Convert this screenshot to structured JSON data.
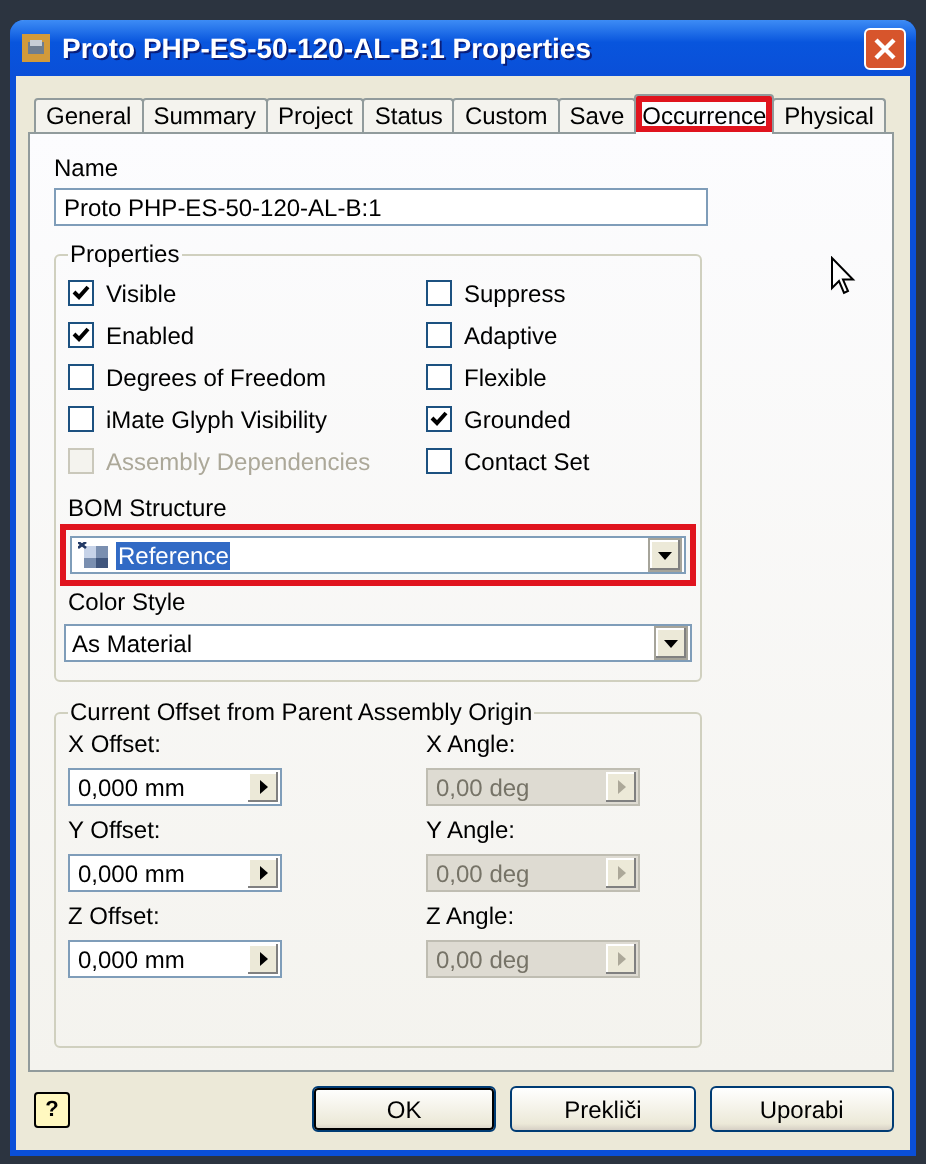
{
  "window": {
    "title": "Proto PHP-ES-50-120-AL-B:1 Properties"
  },
  "tabs": [
    {
      "label": "General",
      "selected": false,
      "highlighted": false
    },
    {
      "label": "Summary",
      "selected": false,
      "highlighted": false
    },
    {
      "label": "Project",
      "selected": false,
      "highlighted": false
    },
    {
      "label": "Status",
      "selected": false,
      "highlighted": false
    },
    {
      "label": "Custom",
      "selected": false,
      "highlighted": false
    },
    {
      "label": "Save",
      "selected": false,
      "highlighted": false
    },
    {
      "label": "Occurrence",
      "selected": true,
      "highlighted": true
    },
    {
      "label": "Physical",
      "selected": false,
      "highlighted": false
    }
  ],
  "name": {
    "label": "Name",
    "value": "Proto PHP-ES-50-120-AL-B:1"
  },
  "properties": {
    "title": "Properties",
    "checkboxes": [
      {
        "label": "Visible",
        "checked": true,
        "disabled": false
      },
      {
        "label": "Suppress",
        "checked": false,
        "disabled": false
      },
      {
        "label": "Enabled",
        "checked": true,
        "disabled": false
      },
      {
        "label": "Adaptive",
        "checked": false,
        "disabled": false
      },
      {
        "label": "Degrees of Freedom",
        "checked": false,
        "disabled": false
      },
      {
        "label": "Flexible",
        "checked": false,
        "disabled": false
      },
      {
        "label": "iMate Glyph Visibility",
        "checked": false,
        "disabled": false
      },
      {
        "label": "Grounded",
        "checked": true,
        "disabled": false
      },
      {
        "label": "Assembly Dependencies",
        "checked": false,
        "disabled": true
      },
      {
        "label": "Contact Set",
        "checked": false,
        "disabled": false
      }
    ],
    "bom_structure": {
      "label": "BOM Structure",
      "value": "Reference",
      "highlighted": true
    },
    "color_style": {
      "label": "Color Style",
      "value": "As Material"
    }
  },
  "offset": {
    "title": "Current Offset from Parent Assembly Origin",
    "fields": [
      {
        "label": "X Offset:",
        "value": "0,000 mm",
        "disabled": false
      },
      {
        "label": "X Angle:",
        "value": "0,00 deg",
        "disabled": true
      },
      {
        "label": "Y Offset:",
        "value": "0,000 mm",
        "disabled": false
      },
      {
        "label": "Y Angle:",
        "value": "0,00 deg",
        "disabled": true
      },
      {
        "label": "Z Offset:",
        "value": "0,000 mm",
        "disabled": false
      },
      {
        "label": "Z Angle:",
        "value": "0,00 deg",
        "disabled": true
      }
    ]
  },
  "help_button": {
    "label": "?"
  },
  "buttons": [
    {
      "label": "OK",
      "default": true
    },
    {
      "label": "Prekliči",
      "default": false
    },
    {
      "label": "Uporabi",
      "default": false
    }
  ]
}
